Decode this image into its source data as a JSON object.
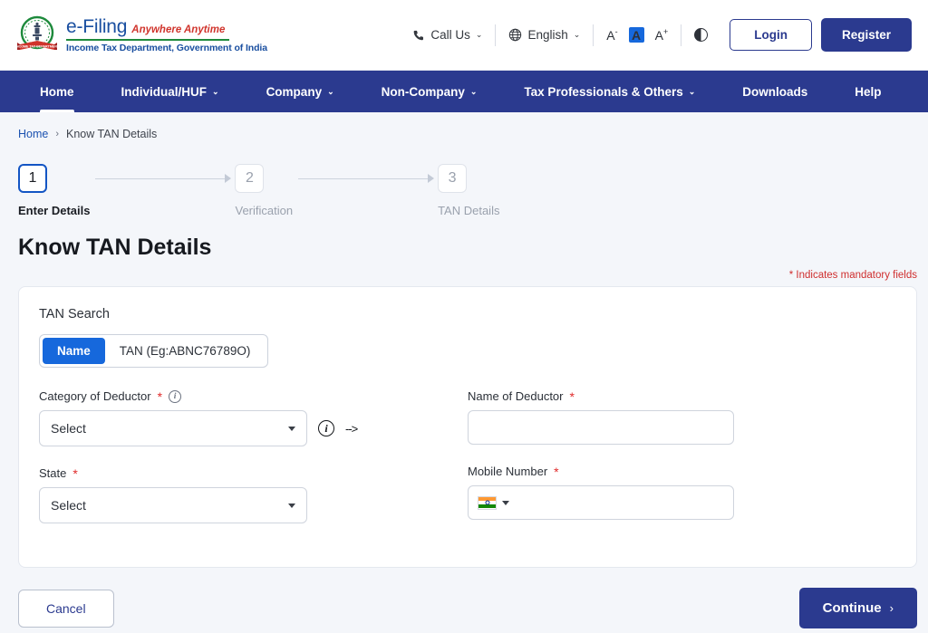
{
  "header": {
    "brand": {
      "efiling": "e-Filing",
      "tagline": "Anywhere Anytime",
      "department": "Income Tax Department, Government of India",
      "emblem_icon": "income-tax-department-emblem",
      "emblem_banner": "INCOME TAX DEPARTMENT"
    },
    "call_us": "Call Us",
    "call_us_icon": "phone-icon",
    "language": "English",
    "language_icon": "globe-icon",
    "font_decrease": "A",
    "font_decrease_sup": "-",
    "font_normal": "A",
    "font_increase": "A",
    "font_increase_sup": "+",
    "contrast_icon": "contrast-icon",
    "login": "Login",
    "register": "Register"
  },
  "nav": {
    "items": [
      {
        "label": "Home",
        "has_caret": false,
        "active": true
      },
      {
        "label": "Individual/HUF",
        "has_caret": true,
        "active": false
      },
      {
        "label": "Company",
        "has_caret": true,
        "active": false
      },
      {
        "label": "Non-Company",
        "has_caret": true,
        "active": false
      },
      {
        "label": "Tax Professionals & Others",
        "has_caret": true,
        "active": false
      },
      {
        "label": "Downloads",
        "has_caret": false,
        "active": false
      },
      {
        "label": "Help",
        "has_caret": false,
        "active": false
      }
    ]
  },
  "breadcrumb": {
    "home": "Home",
    "separator": "›",
    "current": "Know TAN Details"
  },
  "stepper": {
    "steps": [
      {
        "number": "1",
        "label": "Enter Details",
        "state": "active"
      },
      {
        "number": "2",
        "label": "Verification",
        "state": "idle"
      },
      {
        "number": "3",
        "label": "TAN Details",
        "state": "idle"
      }
    ]
  },
  "page": {
    "title": "Know TAN Details",
    "mandatory_note_star": "*",
    "mandatory_note": " Indicates mandatory fields"
  },
  "form": {
    "section_title": "TAN Search",
    "search_toggle": {
      "selected": "Name",
      "options": [
        {
          "label": "Name",
          "selected": true
        },
        {
          "label": "TAN (Eg:ABNC76789O)",
          "selected": false
        }
      ]
    },
    "fields": {
      "category": {
        "label": "Category of Deductor",
        "required": "*",
        "info_icon": "info-icon",
        "value": "Select",
        "trailing_info_icon": "info-icon",
        "annotation": "-->"
      },
      "name_of_deductor": {
        "label": "Name of Deductor",
        "required": "*",
        "value": "",
        "placeholder": ""
      },
      "state": {
        "label": "State",
        "required": "*",
        "value": "Select"
      },
      "mobile": {
        "label": "Mobile Number",
        "required": "*",
        "value": "",
        "placeholder": "",
        "country_flag_icon": "india-flag-icon"
      }
    }
  },
  "footer": {
    "cancel": "Cancel",
    "continue": "Continue",
    "continue_chevron": "›"
  },
  "colors": {
    "nav_navy": "#2b3a8f",
    "accent_blue": "#1668dc",
    "step_active": "#1355c4",
    "required_red": "#e02b2b",
    "page_bg": "#f4f6fa",
    "brand_blue": "#1a4fa0",
    "brand_green": "#1e8a3c",
    "brand_red": "#d0342c"
  }
}
